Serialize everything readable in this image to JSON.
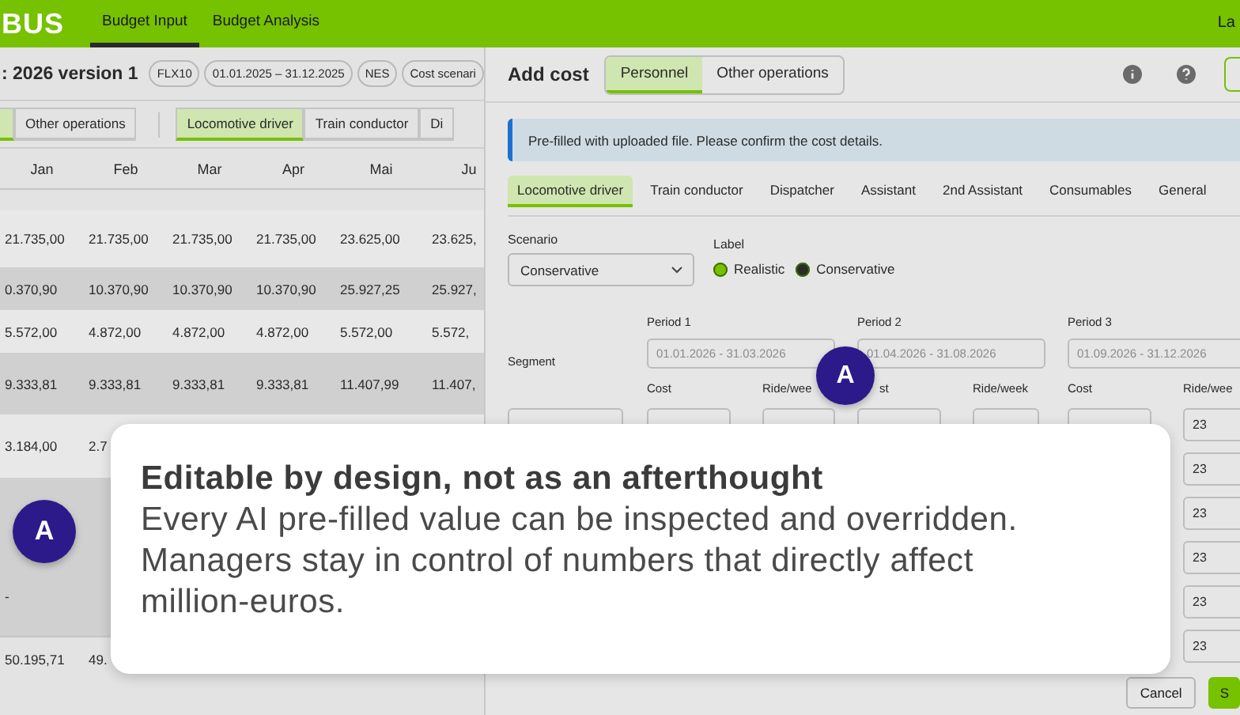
{
  "top_bar": {
    "logo": "BUS",
    "tabs": [
      {
        "label": "Budget Input",
        "selected": true
      },
      {
        "label": "Budget Analysis",
        "selected": false
      }
    ],
    "user": "La"
  },
  "budget": {
    "title": ": 2026 version 1",
    "chips": [
      "FLX10",
      "01.01.2025 – 31.12.2025",
      "NES",
      "Cost scenari"
    ],
    "category_tabs": [
      {
        "selected": true
      },
      {
        "label": "Other operations",
        "selected": false
      }
    ],
    "role_tabs": [
      {
        "label": "Locomotive driver",
        "selected": true
      },
      {
        "label": "Train conductor",
        "selected": false
      },
      {
        "label": "Di",
        "selected": false
      }
    ],
    "columns": [
      "Jan",
      "Feb",
      "Mar",
      "Apr",
      "Mai",
      "Ju"
    ],
    "rows": [
      {
        "shaded": false,
        "cells": [
          "21.735,00",
          "21.735,00",
          "21.735,00",
          "21.735,00",
          "23.625,00",
          "23.625,"
        ]
      },
      {
        "shaded": true,
        "cells": [
          "0.370,90",
          "10.370,90",
          "10.370,90",
          "10.370,90",
          "25.927,25",
          "25.927,"
        ]
      },
      {
        "shaded": false,
        "cells": [
          "5.572,00",
          "4.872,00",
          "4.872,00",
          "4.872,00",
          "5.572,00",
          "5.572,"
        ]
      },
      {
        "shaded": true,
        "cells": [
          "9.333,81",
          "9.333,81",
          "9.333,81",
          "9.333,81",
          "11.407,99",
          "11.407,"
        ]
      },
      {
        "shaded": false,
        "cells": [
          "3.184,00",
          "2.7"
        ]
      },
      {
        "shaded": true,
        "cells": [
          "-"
        ]
      }
    ],
    "total": [
      "50.195,71",
      "49."
    ]
  },
  "add_cost": {
    "title": "Add cost",
    "type_tabs": [
      {
        "label": "Personnel",
        "selected": true
      },
      {
        "label": "Other operations",
        "selected": false
      }
    ],
    "notice": "Pre-filled with uploaded file. Please confirm the cost details.",
    "role_tabs": [
      {
        "label": "Locomotive driver",
        "selected": true
      },
      {
        "label": "Train conductor",
        "selected": false
      },
      {
        "label": "Dispatcher",
        "selected": false
      },
      {
        "label": "Assistant",
        "selected": false
      },
      {
        "label": "2nd Assistant",
        "selected": false
      },
      {
        "label": "Consumables",
        "selected": false
      },
      {
        "label": "General",
        "selected": false
      }
    ],
    "scenario": {
      "label": "Scenario",
      "value": "Conservative"
    },
    "label_field": {
      "label": "Label",
      "options": [
        {
          "label": "Realistic",
          "color": "#76c100"
        },
        {
          "label": "Conservative",
          "color": "#2b2b2b"
        }
      ]
    },
    "segment_label": "Segment",
    "periods": [
      {
        "label": "Period 1",
        "range": "01.01.2026 - 31.03.2026",
        "cost_label": "Cost",
        "ride_label": "Ride/wee"
      },
      {
        "label": "Period 2",
        "range": "01.04.2026 - 31.08.2026",
        "cost_label": "st",
        "ride_label": "Ride/week"
      },
      {
        "label": "Period 3",
        "range": "01.09.2026 - 31.12.2026",
        "cost_label": "Cost",
        "ride_label": "Ride/wee"
      }
    ],
    "ride_values": [
      "23",
      "23",
      "23",
      "23",
      "23",
      "23"
    ],
    "buttons": [
      {
        "label": "Cancel",
        "kind": "secondary"
      },
      {
        "label": "S",
        "kind": "primary"
      }
    ]
  },
  "callout": {
    "heading": "Editable by design, not as an afterthought",
    "body": "Every AI pre-filled value can be inspected and overridden. Managers stay in control of numbers that directly affect million-euros."
  },
  "badges": [
    {
      "label": "A"
    },
    {
      "label": "A"
    }
  ]
}
